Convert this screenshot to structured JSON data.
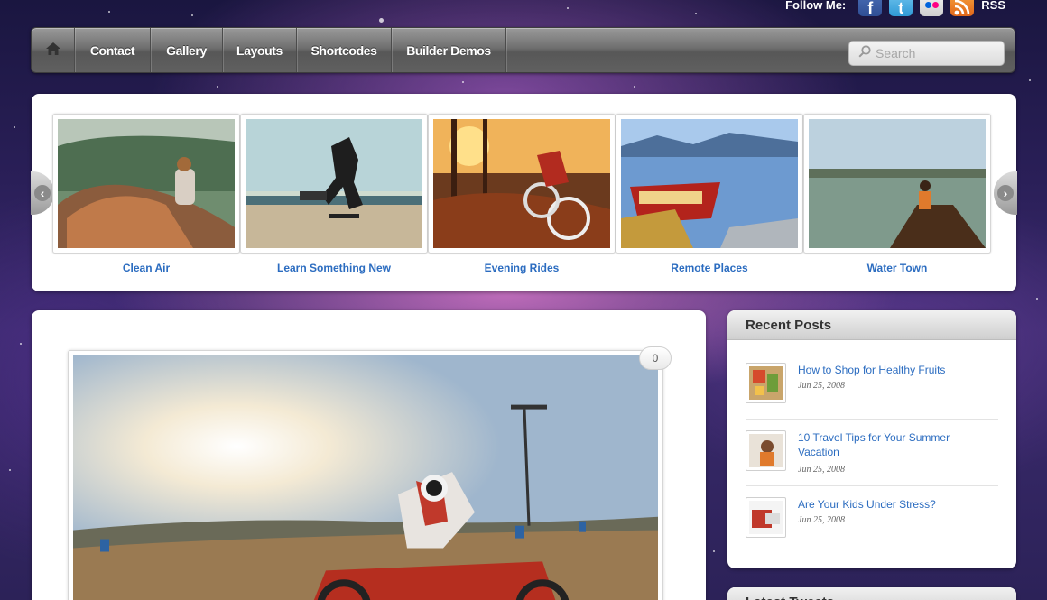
{
  "header": {
    "follow_label": "Follow Me:",
    "social": [
      {
        "name": "facebook",
        "glyph": "f"
      },
      {
        "name": "twitter",
        "glyph": "t"
      },
      {
        "name": "flickr",
        "glyph": ""
      },
      {
        "name": "rss",
        "glyph": ""
      }
    ],
    "rss_label": "RSS"
  },
  "nav": {
    "home_icon": "home-icon",
    "items": [
      {
        "label": "Contact"
      },
      {
        "label": "Gallery"
      },
      {
        "label": "Layouts"
      },
      {
        "label": "Shortcodes"
      },
      {
        "label": "Builder Demos"
      }
    ],
    "search_placeholder": "Search"
  },
  "slider": {
    "prev_icon": "chevron-left-icon",
    "next_icon": "chevron-right-icon",
    "slides": [
      {
        "caption": "Clean Air"
      },
      {
        "caption": "Learn Something New"
      },
      {
        "caption": "Evening Rides"
      },
      {
        "caption": "Remote Places"
      },
      {
        "caption": "Water Town"
      }
    ]
  },
  "post": {
    "comment_count": "0"
  },
  "sidebar": {
    "recent_posts_title": "Recent Posts",
    "recent_posts": [
      {
        "title": "How to Shop for Healthy Fruits",
        "date": "Jun 25, 2008"
      },
      {
        "title": "10 Travel Tips for Your Summer Vacation",
        "date": "Jun 25, 2008"
      },
      {
        "title": "Are Your Kids Under Stress?",
        "date": "Jun 25, 2008"
      }
    ],
    "latest_tweets_title": "Latest Tweets"
  },
  "colors": {
    "link": "#2b6cc0",
    "nav_bg": "#6f6f6f",
    "background": "#2a1f58"
  }
}
